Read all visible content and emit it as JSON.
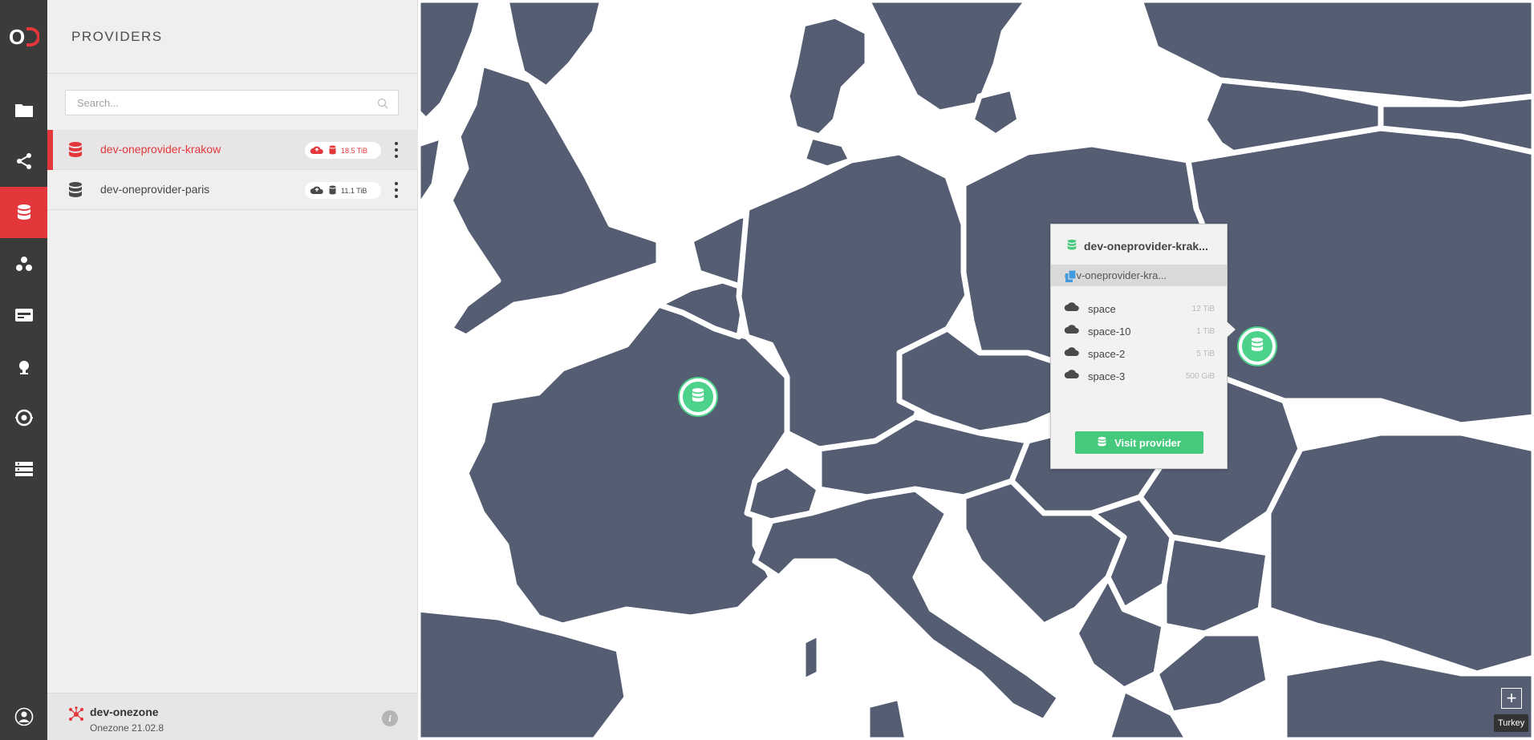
{
  "app": {
    "logo_text": "OD",
    "brand_color": "#e4373b"
  },
  "rail": {
    "items": [
      {
        "name": "data",
        "icon": "folder-icon"
      },
      {
        "name": "shares",
        "icon": "share-icon"
      },
      {
        "name": "providers",
        "icon": "database-icon",
        "active": true
      },
      {
        "name": "groups",
        "icon": "groups-icon"
      },
      {
        "name": "tokens",
        "icon": "token-icon"
      },
      {
        "name": "harvesters",
        "icon": "harvester-icon"
      },
      {
        "name": "automation",
        "icon": "automation-icon"
      },
      {
        "name": "clusters",
        "icon": "clusters-icon"
      }
    ],
    "user_icon": "user-icon"
  },
  "sidebar": {
    "title": "PROVIDERS",
    "search": {
      "placeholder": "Search...",
      "value": ""
    },
    "providers": [
      {
        "name": "dev-oneprovider-krakow",
        "size": "18.5 TiB",
        "selected": true,
        "status": "online"
      },
      {
        "name": "dev-oneprovider-paris",
        "size": "11.1 TiB",
        "selected": false,
        "status": "online"
      }
    ],
    "footer": {
      "zone_name": "dev-onezone",
      "version": "Onezone 21.02.8",
      "info_label": "i"
    }
  },
  "popup": {
    "title": "dev-oneprovider-krak...",
    "domain": "dev-oneprovider-kra...",
    "spaces": [
      {
        "name": "space",
        "size": "12 TiB"
      },
      {
        "name": "space-10",
        "size": "1 TiB"
      },
      {
        "name": "space-2",
        "size": "5 TiB"
      },
      {
        "name": "space-3",
        "size": "500 GiB"
      }
    ],
    "visit_label": "Visit provider"
  },
  "map": {
    "land_color": "#545d71",
    "sea_color": "#ffffff",
    "marker_color": "#4cd28a",
    "zoom_label": "+",
    "tooltip": "Turkey"
  }
}
